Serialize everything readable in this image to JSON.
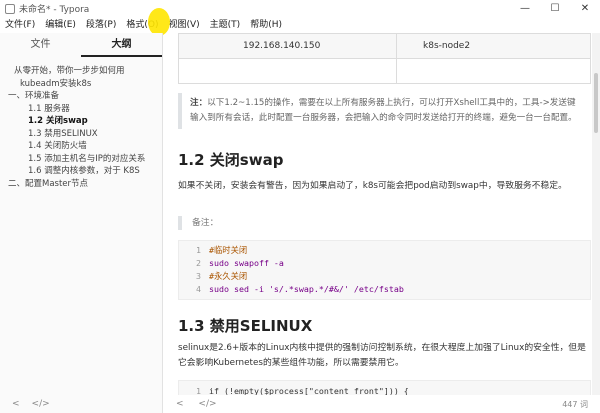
{
  "window": {
    "title": "未命名* - Typora",
    "minimize": "—",
    "maximize": "☐",
    "close": "✕"
  },
  "menu": [
    "文件(F)",
    "编辑(E)",
    "段落(P)",
    "格式(O)",
    "视图(V)",
    "主题(T)",
    "帮助(H)"
  ],
  "sidebar": {
    "tabs": [
      "文件",
      "大纲"
    ],
    "active_tab": "大纲",
    "outline": [
      "从零开始，带你一步步如何用",
      "kubeadm安装k8s",
      "一、环境准备",
      "1.1 服务器",
      "1.2 关闭swap",
      "1.3 禁用SELINUX",
      "1.4 关闭防火墙",
      "1.5 添加主机名与IP的对应关系",
      "1.6 调整内核参数，对于 K8S",
      "二、配置Master节点"
    ],
    "footer_icons": {
      "left": "<",
      "right": "</>"
    }
  },
  "table": [
    [
      "192.168.140.150",
      "k8s-node2"
    ],
    [
      "",
      ""
    ]
  ],
  "note": {
    "label": "注：",
    "text": "以下1.2~1.15的操作，需要在以上所有服务器上执行，可以打开Xshell工具中的，工具->发送键输入到所有会话，此时配置一台服务器，会把输入的命令同时发送给打开的终端，避免一台一台配置。"
  },
  "section_swap": {
    "heading": "1.2 关闭swap",
    "paragraph": "如果不关闭，安装会有警告，因为如果启动了，k8s可能会把pod启动到swap中，导致服务不稳定。",
    "quote": "备注：",
    "code": [
      {
        "n": "1",
        "text": "#临时关闭"
      },
      {
        "n": "2",
        "text": "sudo swapoff -a"
      },
      {
        "n": "3",
        "text": "#永久关闭"
      },
      {
        "n": "4",
        "text": "sudo sed -i 's/.*swap.*/#&/' /etc/fstab"
      }
    ]
  },
  "section_selinux": {
    "heading": "1.3 禁用SELINUX",
    "paragraph": "selinux是2.6+版本的Linux内核中提供的强制访问控制系统，在很大程度上加强了Linux的安全性，但是它会影响Kubernetes的某些组件功能，所以需要禁用它。",
    "code_first_line": {
      "n": "1",
      "text": "if (!empty($process[\"content_front\"])) {"
    }
  },
  "status": {
    "left_icon": "<",
    "right_icon": "</>",
    "words": "447 词"
  }
}
